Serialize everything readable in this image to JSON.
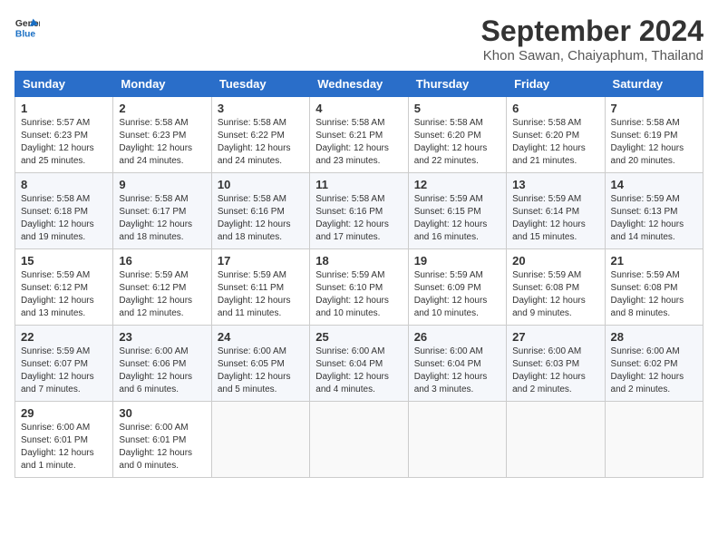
{
  "header": {
    "logo_line1": "General",
    "logo_line2": "Blue",
    "main_title": "September 2024",
    "subtitle": "Khon Sawan, Chaiyaphum, Thailand"
  },
  "calendar": {
    "days_of_week": [
      "Sunday",
      "Monday",
      "Tuesday",
      "Wednesday",
      "Thursday",
      "Friday",
      "Saturday"
    ],
    "weeks": [
      [
        {
          "day": "1",
          "info": "Sunrise: 5:57 AM\nSunset: 6:23 PM\nDaylight: 12 hours\nand 25 minutes."
        },
        {
          "day": "2",
          "info": "Sunrise: 5:58 AM\nSunset: 6:23 PM\nDaylight: 12 hours\nand 24 minutes."
        },
        {
          "day": "3",
          "info": "Sunrise: 5:58 AM\nSunset: 6:22 PM\nDaylight: 12 hours\nand 24 minutes."
        },
        {
          "day": "4",
          "info": "Sunrise: 5:58 AM\nSunset: 6:21 PM\nDaylight: 12 hours\nand 23 minutes."
        },
        {
          "day": "5",
          "info": "Sunrise: 5:58 AM\nSunset: 6:20 PM\nDaylight: 12 hours\nand 22 minutes."
        },
        {
          "day": "6",
          "info": "Sunrise: 5:58 AM\nSunset: 6:20 PM\nDaylight: 12 hours\nand 21 minutes."
        },
        {
          "day": "7",
          "info": "Sunrise: 5:58 AM\nSunset: 6:19 PM\nDaylight: 12 hours\nand 20 minutes."
        }
      ],
      [
        {
          "day": "8",
          "info": "Sunrise: 5:58 AM\nSunset: 6:18 PM\nDaylight: 12 hours\nand 19 minutes."
        },
        {
          "day": "9",
          "info": "Sunrise: 5:58 AM\nSunset: 6:17 PM\nDaylight: 12 hours\nand 18 minutes."
        },
        {
          "day": "10",
          "info": "Sunrise: 5:58 AM\nSunset: 6:16 PM\nDaylight: 12 hours\nand 18 minutes."
        },
        {
          "day": "11",
          "info": "Sunrise: 5:58 AM\nSunset: 6:16 PM\nDaylight: 12 hours\nand 17 minutes."
        },
        {
          "day": "12",
          "info": "Sunrise: 5:59 AM\nSunset: 6:15 PM\nDaylight: 12 hours\nand 16 minutes."
        },
        {
          "day": "13",
          "info": "Sunrise: 5:59 AM\nSunset: 6:14 PM\nDaylight: 12 hours\nand 15 minutes."
        },
        {
          "day": "14",
          "info": "Sunrise: 5:59 AM\nSunset: 6:13 PM\nDaylight: 12 hours\nand 14 minutes."
        }
      ],
      [
        {
          "day": "15",
          "info": "Sunrise: 5:59 AM\nSunset: 6:12 PM\nDaylight: 12 hours\nand 13 minutes."
        },
        {
          "day": "16",
          "info": "Sunrise: 5:59 AM\nSunset: 6:12 PM\nDaylight: 12 hours\nand 12 minutes."
        },
        {
          "day": "17",
          "info": "Sunrise: 5:59 AM\nSunset: 6:11 PM\nDaylight: 12 hours\nand 11 minutes."
        },
        {
          "day": "18",
          "info": "Sunrise: 5:59 AM\nSunset: 6:10 PM\nDaylight: 12 hours\nand 10 minutes."
        },
        {
          "day": "19",
          "info": "Sunrise: 5:59 AM\nSunset: 6:09 PM\nDaylight: 12 hours\nand 10 minutes."
        },
        {
          "day": "20",
          "info": "Sunrise: 5:59 AM\nSunset: 6:08 PM\nDaylight: 12 hours\nand 9 minutes."
        },
        {
          "day": "21",
          "info": "Sunrise: 5:59 AM\nSunset: 6:08 PM\nDaylight: 12 hours\nand 8 minutes."
        }
      ],
      [
        {
          "day": "22",
          "info": "Sunrise: 5:59 AM\nSunset: 6:07 PM\nDaylight: 12 hours\nand 7 minutes."
        },
        {
          "day": "23",
          "info": "Sunrise: 6:00 AM\nSunset: 6:06 PM\nDaylight: 12 hours\nand 6 minutes."
        },
        {
          "day": "24",
          "info": "Sunrise: 6:00 AM\nSunset: 6:05 PM\nDaylight: 12 hours\nand 5 minutes."
        },
        {
          "day": "25",
          "info": "Sunrise: 6:00 AM\nSunset: 6:04 PM\nDaylight: 12 hours\nand 4 minutes."
        },
        {
          "day": "26",
          "info": "Sunrise: 6:00 AM\nSunset: 6:04 PM\nDaylight: 12 hours\nand 3 minutes."
        },
        {
          "day": "27",
          "info": "Sunrise: 6:00 AM\nSunset: 6:03 PM\nDaylight: 12 hours\nand 2 minutes."
        },
        {
          "day": "28",
          "info": "Sunrise: 6:00 AM\nSunset: 6:02 PM\nDaylight: 12 hours\nand 2 minutes."
        }
      ],
      [
        {
          "day": "29",
          "info": "Sunrise: 6:00 AM\nSunset: 6:01 PM\nDaylight: 12 hours\nand 1 minute."
        },
        {
          "day": "30",
          "info": "Sunrise: 6:00 AM\nSunset: 6:01 PM\nDaylight: 12 hours\nand 0 minutes."
        },
        {
          "day": "",
          "info": ""
        },
        {
          "day": "",
          "info": ""
        },
        {
          "day": "",
          "info": ""
        },
        {
          "day": "",
          "info": ""
        },
        {
          "day": "",
          "info": ""
        }
      ]
    ]
  }
}
